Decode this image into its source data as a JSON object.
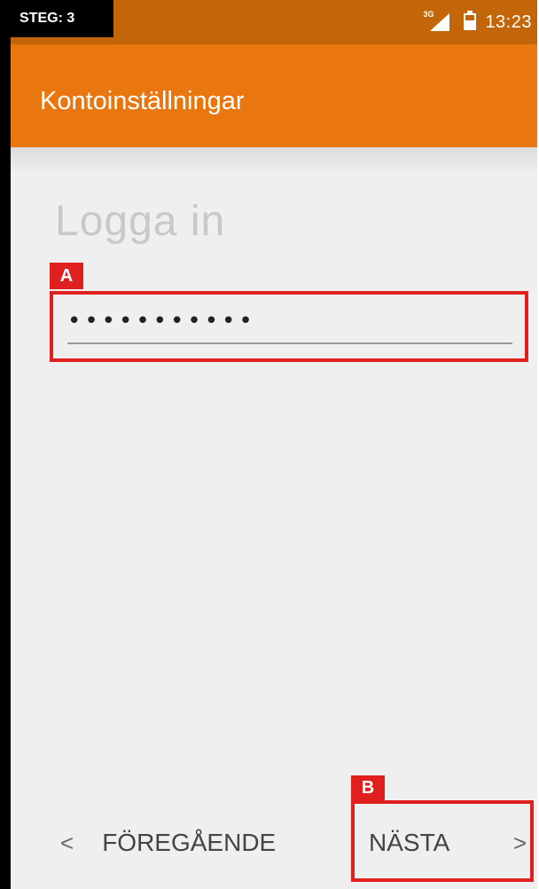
{
  "status_bar": {
    "step_label": "STEG: 3",
    "network_label": "3G",
    "time": "13:23"
  },
  "app_bar": {
    "title": "Kontoinställningar"
  },
  "content": {
    "heading": "Logga in",
    "password_value": "•••••••••••",
    "callout_a": "A",
    "callout_b": "B"
  },
  "nav": {
    "prev_label": "FÖREGÅENDE",
    "next_label": "NÄSTA",
    "prev_chevron": "<",
    "next_chevron": ">"
  },
  "colors": {
    "app_bar": "#e9760f",
    "status_bar": "#c36609",
    "callout": "#e01f1f",
    "background": "#efefef"
  },
  "icons": {
    "network": "signal-3g-icon",
    "battery": "battery-icon"
  }
}
